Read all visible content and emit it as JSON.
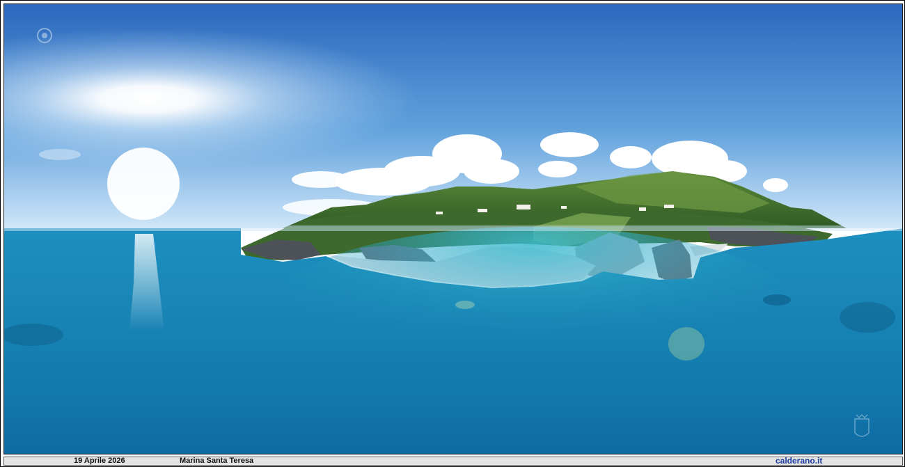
{
  "photo": {
    "subject_icon": "panorama-photo",
    "watermark_icon": "crest-logo",
    "stamp_icon": "town-seal"
  },
  "caption": {
    "date": "19 Aprile 2026",
    "place": "Marina Santa Teresa",
    "site": "calderano.it"
  },
  "colors": {
    "sky_top": "#2f6fc4",
    "sky_horizon": "#cfe6f8",
    "sea_deep": "#1266a6",
    "sea_shallow": "#26a2c6",
    "caption_bg": "#e4e4e4",
    "link": "#1a3a9a"
  }
}
